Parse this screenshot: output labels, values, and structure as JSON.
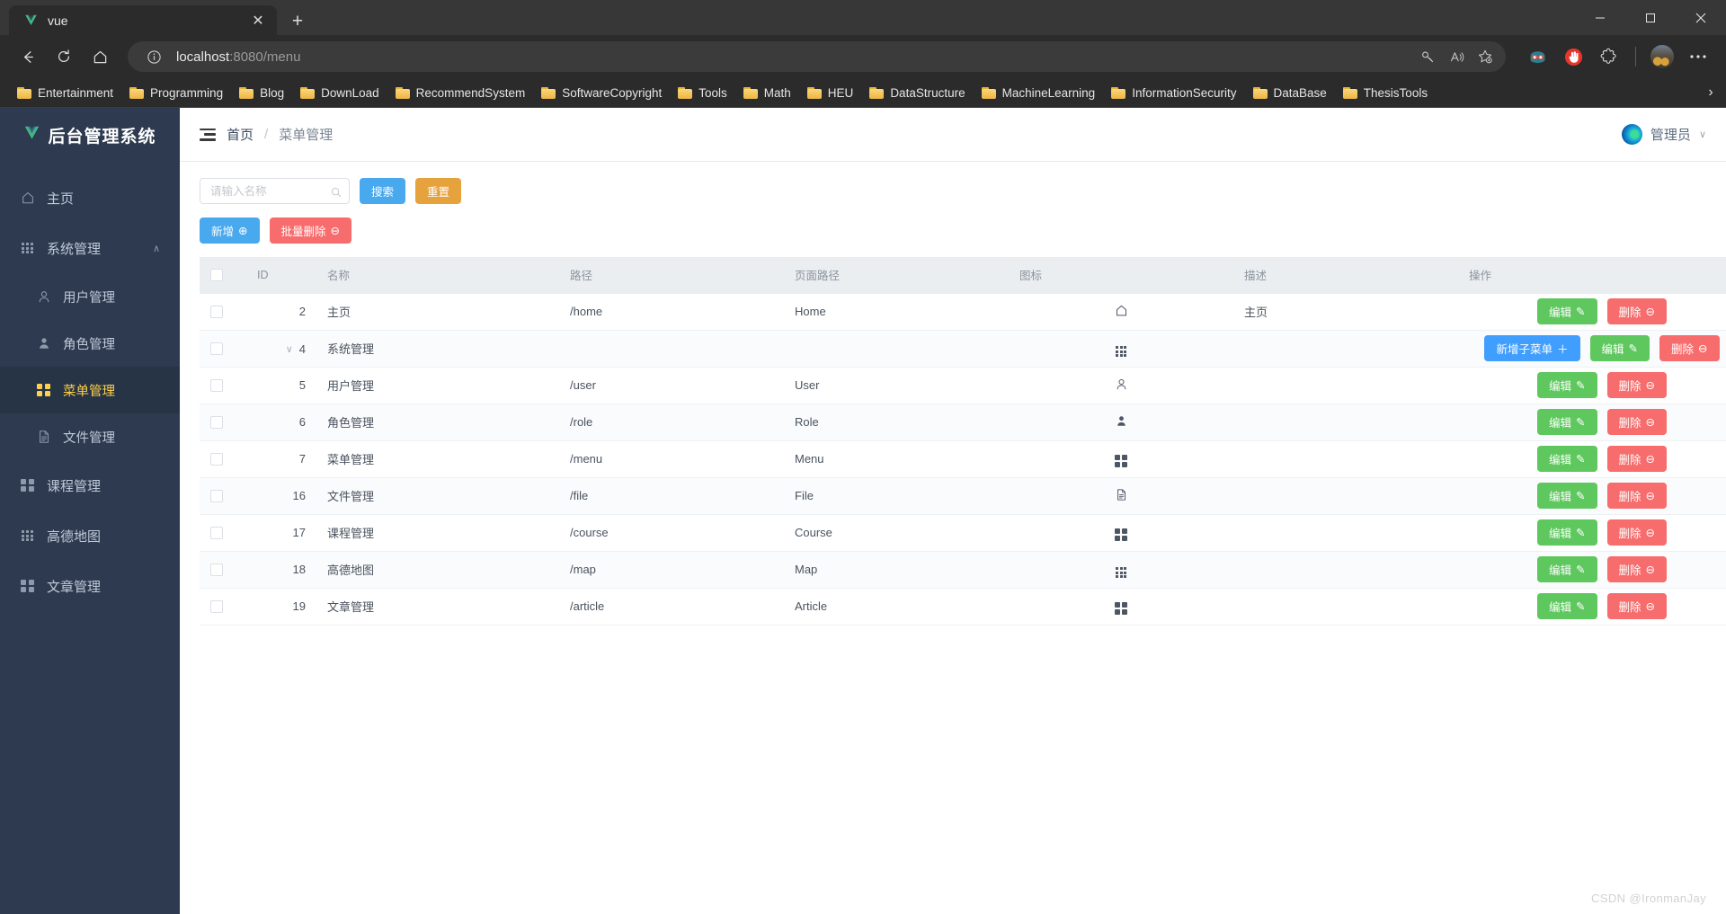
{
  "browser": {
    "tab": {
      "title": "vue",
      "favicon": "vue-logo-icon",
      "close_label": "✕"
    },
    "newtab_label": "+",
    "window_controls": {
      "minimize": "─",
      "maximize": "☐",
      "close": "✕"
    },
    "nav": {
      "back": "←",
      "reload": "↻",
      "home": "⌂"
    },
    "address": {
      "info_icon": "info-icon",
      "host": "localhost",
      "rest": ":8080/menu"
    },
    "omnibox_icons": [
      "key-icon",
      "read-aloud-icon",
      "add-favorite-icon"
    ],
    "toolbar_icons": [
      "collections-icon",
      "ublock-icon",
      "extensions-icon",
      "profile-avatar",
      "more-icon"
    ],
    "bookmarks": [
      "Entertainment",
      "Programming",
      "Blog",
      "DownLoad",
      "RecommendSystem",
      "SoftwareCopyright",
      "Tools",
      "Math",
      "HEU",
      "DataStructure",
      "MachineLearning",
      "InformationSecurity",
      "DataBase",
      "ThesisTools"
    ],
    "bookmarks_overflow": "›"
  },
  "sidebar": {
    "logo_mark": "V",
    "logo_text": "后台管理系统",
    "items": [
      {
        "label": "主页",
        "icon": "home-icon",
        "level": 0,
        "active": false
      },
      {
        "label": "系统管理",
        "icon": "grid3-icon",
        "level": 0,
        "active": false,
        "expanded": true,
        "arrow": "∧"
      },
      {
        "label": "用户管理",
        "icon": "user-outline-icon",
        "level": 1,
        "active": false
      },
      {
        "label": "角色管理",
        "icon": "user-solid-icon",
        "level": 1,
        "active": false
      },
      {
        "label": "菜单管理",
        "icon": "grid2-icon",
        "level": 1,
        "active": true
      },
      {
        "label": "文件管理",
        "icon": "document-icon",
        "level": 1,
        "active": false
      },
      {
        "label": "课程管理",
        "icon": "grid2-icon",
        "level": 0,
        "active": false
      },
      {
        "label": "高德地图",
        "icon": "grid3-icon",
        "level": 0,
        "active": false
      },
      {
        "label": "文章管理",
        "icon": "grid2-icon",
        "level": 0,
        "active": false
      }
    ]
  },
  "topbar": {
    "collapse_icon": "hamburger-icon",
    "breadcrumb": {
      "root": "首页",
      "separator": "/",
      "current": "菜单管理"
    },
    "user": {
      "name": "管理员",
      "avatar": "user-avatar",
      "caret": "∨"
    }
  },
  "search": {
    "placeholder": "请输入名称",
    "value": "",
    "search_label": "搜索",
    "reset_label": "重置"
  },
  "toolbar": {
    "add_label": "新增",
    "add_icon": "⊕",
    "batch_delete_label": "批量删除",
    "batch_delete_icon": "⊖"
  },
  "table": {
    "headers": {
      "checkbox": "",
      "id": "ID",
      "name": "名称",
      "path": "路径",
      "page_path": "页面路径",
      "icon": "图标",
      "description": "描述",
      "operations": "操作"
    },
    "row_buttons": {
      "edit": "编辑",
      "edit_icon": "✎",
      "delete": "删除",
      "delete_icon": "⊖",
      "add_sub": "新增子菜单",
      "add_sub_icon": "＋"
    },
    "rows": [
      {
        "id": "2",
        "name": "主页",
        "path": "/home",
        "page": "Home",
        "icon": "home-icon",
        "desc": "主页",
        "expandable": false,
        "has_add_sub": false
      },
      {
        "id": "4",
        "name": "系统管理",
        "path": "",
        "page": "",
        "icon": "grid3-icon",
        "desc": "",
        "expandable": true,
        "has_add_sub": true
      },
      {
        "id": "5",
        "name": "用户管理",
        "path": "/user",
        "page": "User",
        "icon": "user-outline-icon",
        "desc": "",
        "expandable": false,
        "has_add_sub": false
      },
      {
        "id": "6",
        "name": "角色管理",
        "path": "/role",
        "page": "Role",
        "icon": "user-solid-icon",
        "desc": "",
        "expandable": false,
        "has_add_sub": false
      },
      {
        "id": "7",
        "name": "菜单管理",
        "path": "/menu",
        "page": "Menu",
        "icon": "grid2-icon",
        "desc": "",
        "expandable": false,
        "has_add_sub": false
      },
      {
        "id": "16",
        "name": "文件管理",
        "path": "/file",
        "page": "File",
        "icon": "document-icon",
        "desc": "",
        "expandable": false,
        "has_add_sub": false
      },
      {
        "id": "17",
        "name": "课程管理",
        "path": "/course",
        "page": "Course",
        "icon": "grid2-icon",
        "desc": "",
        "expandable": false,
        "has_add_sub": false
      },
      {
        "id": "18",
        "name": "高德地图",
        "path": "/map",
        "page": "Map",
        "icon": "grid3-icon",
        "desc": "",
        "expandable": false,
        "has_add_sub": false
      },
      {
        "id": "19",
        "name": "文章管理",
        "path": "/article",
        "page": "Article",
        "icon": "grid2-icon",
        "desc": "",
        "expandable": false,
        "has_add_sub": false
      }
    ]
  },
  "watermark": "CSDN @IronmanJay",
  "colors": {
    "sidebar_bg": "#2d3a4f",
    "sidebar_active_bg": "#263445",
    "accent_active": "#ffd04b",
    "vue_green": "#41b883",
    "primary_blue": "#409eff",
    "search_blue": "#49a9ee",
    "reset_orange": "#e6a23c",
    "danger_red": "#f76c6c",
    "edit_green": "#5ec75e"
  }
}
